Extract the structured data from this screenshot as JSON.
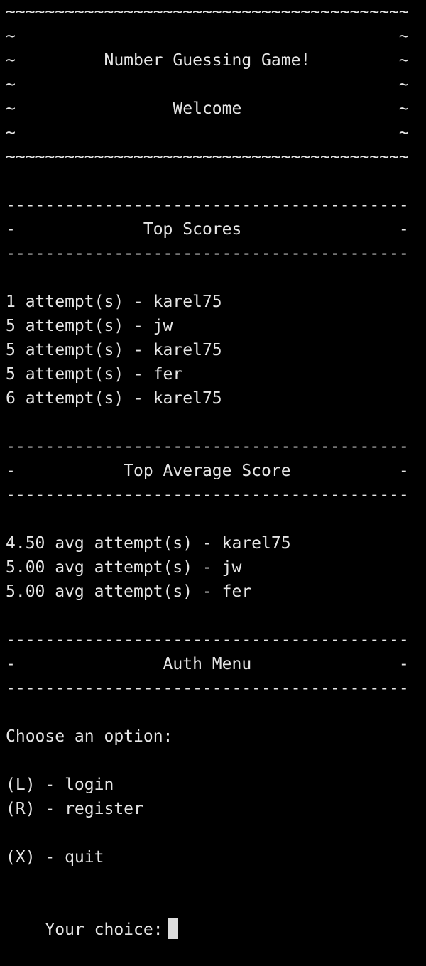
{
  "colors": {
    "background": "#000000",
    "foreground": "#e6e6e6",
    "cursor": "#dcdcdc"
  },
  "banner": {
    "border": "~~~~~~~~~~~~~~~~~~~~~~~~~~~~~~~~~~~~~~~~~",
    "blank": "~                                       ~",
    "title": "~         Number Guessing Game!         ~",
    "subtitle": "~                Welcome                ~"
  },
  "divider": "-----------------------------------------",
  "top_scores": {
    "header": "-             Top Scores                -",
    "rows": [
      "1 attempt(s) - karel75",
      "5 attempt(s) - jw",
      "5 attempt(s) - karel75",
      "5 attempt(s) - fer",
      "6 attempt(s) - karel75"
    ]
  },
  "top_average": {
    "header": "-           Top Average Score           -",
    "rows": [
      "4.50 avg attempt(s) - karel75",
      "5.00 avg attempt(s) - jw",
      "5.00 avg attempt(s) - fer"
    ]
  },
  "auth_menu": {
    "header": "-               Auth Menu               -",
    "prompt": "Choose an option:",
    "options": [
      "(L) - login",
      "(R) - register",
      "(X) - quit"
    ],
    "input_prompt": "Your choice:"
  }
}
